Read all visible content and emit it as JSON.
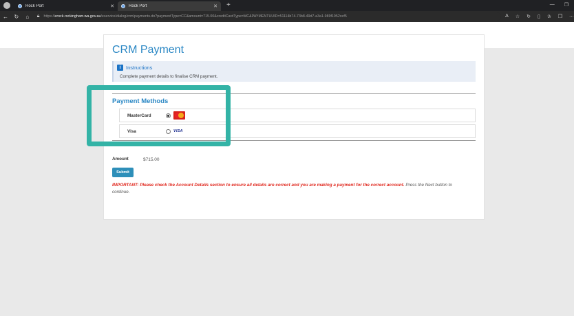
{
  "browser": {
    "tabs": [
      {
        "label": "Rock Port"
      },
      {
        "label": "Rock Port"
      }
    ],
    "url": {
      "prefix": "https://",
      "host": "erock.rockingham.wa.gov.au",
      "path": "/eservice/dialog/crm/payments.do?paymentType=CC&amount=715.00&creditCardType=MC&PAYMENTUUID=51114b74-73b8-49d7-a3a1-989f1952cef5"
    }
  },
  "page": {
    "title": "CRM Payment",
    "instructions": {
      "heading": "Instructions",
      "text": "Complete payment details to finalise CRM payment."
    },
    "payment_methods": {
      "heading": "Payment Methods",
      "options": [
        {
          "label": "MasterCard",
          "selected": true,
          "logo": "mastercard-logo"
        },
        {
          "label": "Visa",
          "selected": false,
          "logo": "visa-logo",
          "logo_text": "VISA"
        }
      ]
    },
    "amount": {
      "label": "Amount",
      "value": "$715.00"
    },
    "submit_label": "Submit",
    "important": {
      "red_text": "IMPORTANT: Please check the Account Details section to ensure all details are correct and you are making a payment for the correct account.",
      "normal_text": " Press the Next button to continue."
    }
  },
  "colors": {
    "accent": "#2a87c4",
    "highlight": "#33b3a6",
    "warning": "#e0271d",
    "submit": "#2e8fb9"
  }
}
